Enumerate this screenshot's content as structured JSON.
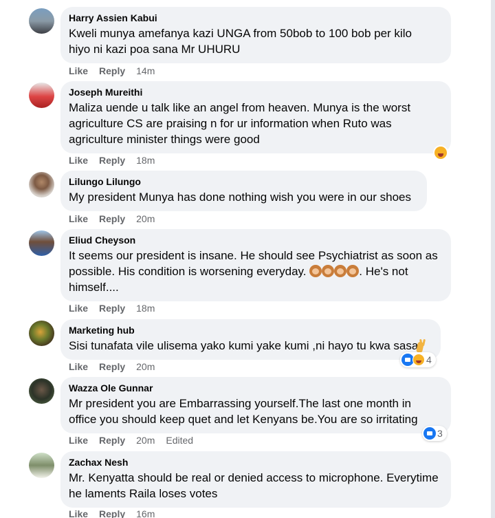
{
  "comments": [
    {
      "author": "Harry Assien Kabui",
      "lines": [
        "Kweli munya amefanya kazi UNGA from 50bob to 100 bob per kilo",
        "hiyo ni kazi poa sana Mr UHURU"
      ],
      "like": "Like",
      "reply": "Reply",
      "time": "14m"
    },
    {
      "author": "Joseph Mureithi",
      "lines": [
        "Maliza uende u talk like an angel from heaven. Munya is the worst",
        "agriculture CS are praising n for ur information when Ruto was",
        "agriculture minister things were good"
      ],
      "like": "Like",
      "reply": "Reply",
      "time": "18m"
    },
    {
      "author": "Lilungo Lilungo",
      "lines": [
        "My president Munya has done nothing wish you were in our shoes"
      ],
      "like": "Like",
      "reply": "Reply",
      "time": "20m"
    },
    {
      "author": "Eliud Cheyson",
      "lines": [
        "It seems our president is insane. He should see Psychiatrist as soon as",
        "possible. His condition is worsening everyday.",
        ". He's not",
        "himself...."
      ],
      "like": "Like",
      "reply": "Reply",
      "time": "18m"
    },
    {
      "author": "Marketing hub",
      "lines": [
        "Sisi tunafata vile ulisema yako kumi yake kumi ,ni hayo tu kwa sasa"
      ],
      "like": "Like",
      "reply": "Reply",
      "time": "20m",
      "reaction_count": "4"
    },
    {
      "author": "Wazza Ole Gunnar",
      "lines": [
        "Mr president you are Embarrassing yourself.The last one month in",
        "office you should keep quet and let Kenyans be.You are so irritating"
      ],
      "like": "Like",
      "reply": "Reply",
      "time": "20m",
      "edited": "Edited",
      "reaction_count": "3"
    },
    {
      "author": "Zachax Nesh",
      "lines": [
        "Mr. Kenyatta should be real or denied access to microphone. Everytime",
        "he laments Raila loses votes"
      ],
      "like": "Like",
      "reply": "Reply",
      "time": "16m"
    }
  ],
  "colors": {
    "bubble": "#f0f2f5",
    "meta": "#65676b",
    "like_blue": "#1877f2",
    "haha_yellow": "#f7b125"
  },
  "icons": [
    "haha-emoji-icon",
    "monkey-emoji-icon",
    "peace-hand-emoji-icon",
    "like-reaction-icon"
  ]
}
